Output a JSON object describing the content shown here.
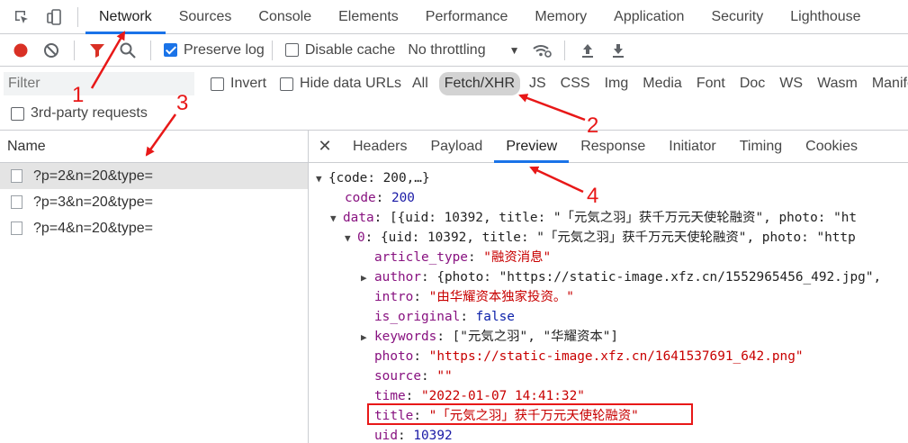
{
  "top_tabs": [
    "Network",
    "Sources",
    "Console",
    "Elements",
    "Performance",
    "Memory",
    "Application",
    "Security",
    "Lighthouse"
  ],
  "toolbar": {
    "preserve_log": "Preserve log",
    "disable_cache": "Disable cache",
    "throttling": "No throttling"
  },
  "filter": {
    "placeholder": "Filter",
    "invert": "Invert",
    "hide_data_urls": "Hide data URLs",
    "types": [
      "All",
      "Fetch/XHR",
      "JS",
      "CSS",
      "Img",
      "Media",
      "Font",
      "Doc",
      "WS",
      "Wasm",
      "Manifest"
    ]
  },
  "third_party": "3rd-party requests",
  "requests": {
    "header": "Name",
    "items": [
      "?p=2&n=20&type=",
      "?p=3&n=20&type=",
      "?p=4&n=20&type="
    ]
  },
  "detail_tabs": [
    "Headers",
    "Payload",
    "Preview",
    "Response",
    "Initiator",
    "Timing",
    "Cookies"
  ],
  "preview": {
    "root": "{code: 200,…}",
    "code_key": "code",
    "code_val": "200",
    "data_key": "data",
    "data_summary": "[{uid: 10392, title: \"「元気之羽」获千万元天使轮融资\", photo: \"ht",
    "item0_key": "0",
    "item0_summary": "{uid: 10392, title: \"「元気之羽」获千万元天使轮融资\", photo: \"http",
    "article_type_key": "article_type",
    "article_type_val": "\"融资消息\"",
    "author_key": "author",
    "author_val": "{photo: \"https://static-image.xfz.cn/1552965456_492.jpg\",",
    "intro_key": "intro",
    "intro_val": "\"由华耀资本独家投资。\"",
    "is_original_key": "is_original",
    "is_original_val": "false",
    "keywords_key": "keywords",
    "keywords_val": "[\"元気之羽\", \"华耀资本\"]",
    "photo_key": "photo",
    "photo_val": "\"https://static-image.xfz.cn/1641537691_642.png\"",
    "source_key": "source",
    "source_val": "\"\"",
    "time_key": "time",
    "time_val": "\"2022-01-07 14:41:32\"",
    "title_key": "title",
    "title_val": "\"「元気之羽」获千万元天使轮融资\"",
    "uid_key": "uid",
    "uid_val": "10392"
  },
  "annotations": [
    "1",
    "2",
    "3",
    "4"
  ],
  "colors": {
    "accent": "#1a73e8",
    "annotation": "#e81818",
    "record": "#d93025"
  }
}
